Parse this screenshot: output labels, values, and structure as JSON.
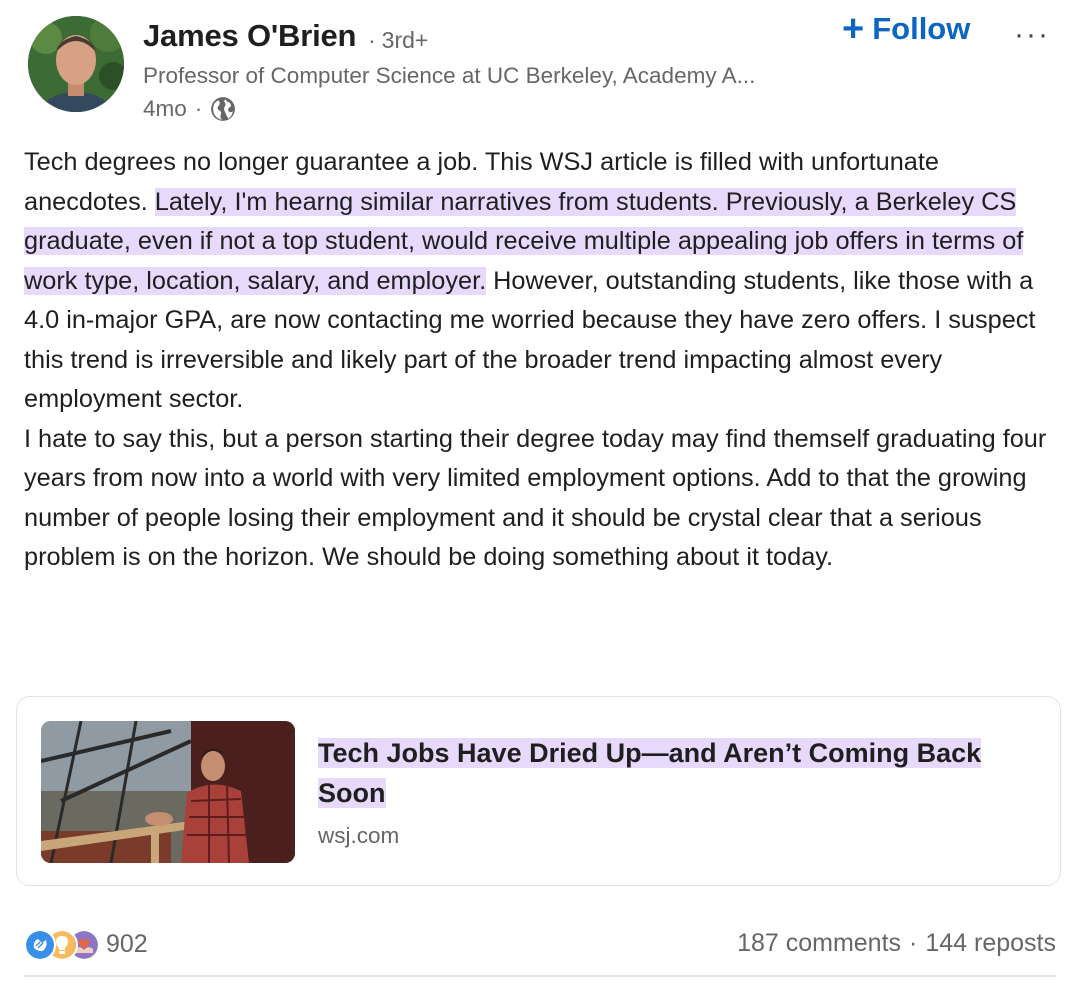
{
  "author": {
    "name": "James O'Brien",
    "degree": "3rd+",
    "headline": "Professor of Computer Science at UC Berkeley, Academy A...",
    "time_ago": "4mo",
    "visibility_icon": "globe-icon"
  },
  "actions": {
    "follow_label": "Follow",
    "follow_icon": "plus-icon",
    "more_icon": "more-icon"
  },
  "post": {
    "p1_a": "Tech degrees no longer guarantee a job. This WSJ article is filled with unfortunate anecdotes. ",
    "p1_highlight": "Lately, I'm hearng similar narratives from students. Previously, a Berkeley CS graduate, even if not a top student, would receive multiple appealing job offers in terms of work type, location, salary, and employer.",
    "p1_b": " However, outstanding students, like those with a 4.0 in-major GPA, are now contacting me worried because they have zero offers. I suspect this trend is irreversible and likely part of the broader trend impacting almost every employment sector.",
    "p2": "I hate to say this, but a person starting their degree today may find themself graduating four years from now into a world with very limited employment options. Add to that the growing number of people losing their employment and it should be crystal clear that a serious problem is on the horizon. We should be doing something about it today."
  },
  "article": {
    "title": "Tech Jobs Have Dried Up—and Aren’t Coming Back Soon",
    "source": "wsj.com"
  },
  "social": {
    "reactions_count": "902",
    "reaction_icons": [
      "clap-icon",
      "lightbulb-icon",
      "heart-hands-icon"
    ],
    "comments": "187 comments",
    "reposts": "144 reposts",
    "separator": "·"
  },
  "colors": {
    "accent": "#0a66c2",
    "highlight": "#e6d9fb",
    "muted_text": "#666666"
  }
}
